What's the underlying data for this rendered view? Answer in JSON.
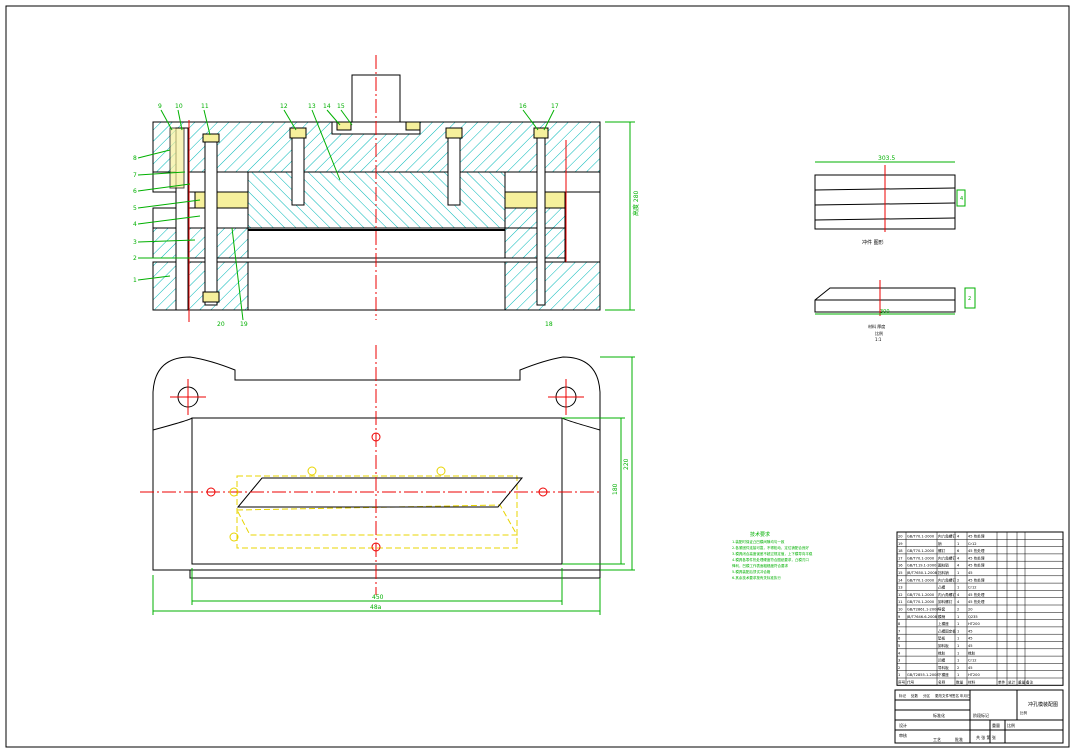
{
  "drawing": {
    "part_labels": [
      "1",
      "2",
      "3",
      "4",
      "5",
      "6",
      "7",
      "8",
      "9",
      "10",
      "11",
      "12",
      "13",
      "14",
      "15",
      "16",
      "17",
      "18",
      "19",
      "20",
      "19"
    ],
    "top_dims": {
      "height": "高度 280"
    },
    "plan_dims": {
      "depth_outer": "220",
      "depth_inner": "180",
      "width_inner": "450",
      "width_outer": "48a"
    },
    "part_view": {
      "width": "303.5",
      "thickness": "4",
      "title": "冲件 图形"
    },
    "blank_view": {
      "length": "300",
      "thickness": "2",
      "note_a": "材料 厚度",
      "note_b": "比例",
      "note_c": "1:1"
    },
    "notes": {
      "title": "技术要求",
      "lines": [
        "1.装配时保证凸凹模间隙均匀一致",
        "2.各紧固件连接可靠，不得松动，定位销配合良好",
        "3.模具闭合高度误差不超过规定值，上下模导向平稳",
        "4.模具各零件热处理硬度符合图纸要求，凸模刃口",
        "  锋利，凹模工作表面粗糙度符合要求",
        "5.模具装配后须试冲合格",
        "6.其余技术要求按有关标准执行"
      ]
    },
    "bom_rows": [
      [
        "20",
        "GB/T70.1-2000",
        "内六角螺钉",
        "4",
        "45 热处理"
      ],
      [
        "19",
        "",
        "销",
        "1",
        "Cr12"
      ],
      [
        "18",
        "GB/T70.1-2000",
        "螺钉",
        "6",
        "45 热处理"
      ],
      [
        "17",
        "GB/T70.1-2000",
        "内六角螺钉",
        "4",
        "45 热处理"
      ],
      [
        "16",
        "GB/T119.1-2000",
        "圆柱销",
        "4",
        "45 热处理"
      ],
      [
        "15",
        "JB/T7650.1-2008",
        "挡料销",
        "1",
        "45"
      ],
      [
        "14",
        "GB/T70.1-2000",
        "内六角螺钉",
        "2",
        "45 热处理"
      ],
      [
        "13",
        "",
        "凸模",
        "1",
        "Cr12"
      ],
      [
        "12",
        "GB/T70.1-2000",
        "内六角螺钉",
        "4",
        "45 热处理"
      ],
      [
        "11",
        "GB/T70.1-2000",
        "卸料螺钉",
        "4",
        "45 热处理"
      ],
      [
        "10",
        "GB/T2861.1-2008",
        "导套",
        "2",
        "20"
      ],
      [
        "9",
        "JB/T7646.6-2008",
        "模柄",
        "1",
        "Q235"
      ],
      [
        "8",
        "",
        "上模座",
        "1",
        "HT200"
      ],
      [
        "7",
        "",
        "凸模固定板",
        "1",
        "45"
      ],
      [
        "6",
        "",
        "垫板",
        "1",
        "45"
      ],
      [
        "5",
        "",
        "卸料板",
        "1",
        "45"
      ],
      [
        "4",
        "",
        "橡胶",
        "1",
        "橡胶"
      ],
      [
        "3",
        "",
        "凹模",
        "1",
        "Cr12"
      ],
      [
        "2",
        "",
        "导料板",
        "2",
        "45"
      ],
      [
        "1",
        "GB/T2855.1-2008",
        "下模座",
        "1",
        "HT200"
      ]
    ],
    "bom_header": [
      "序号",
      "代号",
      "名称",
      "数量",
      "材料",
      "单件",
      "总计",
      "重量",
      "备注"
    ],
    "title_block": {
      "drawing_name": "冲孔模装配图",
      "ratio_label": "比例",
      "sheet_label": "共 张 第 张",
      "cells": [
        "标记",
        "处数",
        "分区",
        "更改文件号",
        "签名",
        "年月日",
        "设计",
        "标准化",
        "审核",
        "工艺",
        "批准",
        "阶段标记",
        "重量",
        "比例"
      ]
    }
  }
}
